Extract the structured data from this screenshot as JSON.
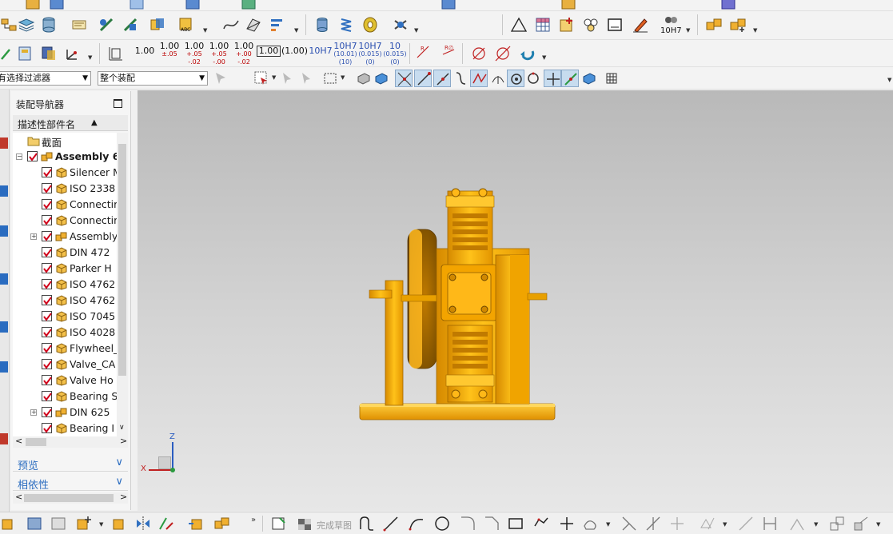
{
  "toolbar": {
    "dimension_buttons": [
      {
        "main": "1.00",
        "sub": ""
      },
      {
        "main": "1.00",
        "sub": "±.05"
      },
      {
        "main": "1.00",
        "sub": "+.05 -.02"
      },
      {
        "main": "1.00",
        "sub": "+.05 -.00"
      },
      {
        "main": "1.00",
        "sub": "+.00 -.02"
      },
      {
        "main": "1.00",
        "sub": ""
      },
      {
        "main": "(1.00)",
        "sub": ""
      },
      {
        "main": "10H7",
        "sub": ""
      },
      {
        "main": "10H7",
        "sub": "(10.01) (10)"
      },
      {
        "main": "10H7",
        "sub": "(0.015) (0)"
      },
      {
        "main": "10",
        "sub": "(0.015) (0)"
      }
    ],
    "fit_label": "10H7",
    "finish_sketch_label": "完成草图"
  },
  "filterbar": {
    "selection_filter": "有选择过滤器",
    "scope": "整个装配"
  },
  "navigator": {
    "title": "装配导航器",
    "column_header": "描述性部件名",
    "sort_indicator": "▲",
    "items": [
      {
        "label": "截面",
        "type": "folder",
        "level": 1,
        "checked": false,
        "bold": false,
        "expandable": false
      },
      {
        "label": "Assembly 6",
        "type": "assembly",
        "level": 1,
        "checked": true,
        "bold": true,
        "expandable": true
      },
      {
        "label": "Silencer M",
        "type": "part",
        "level": 2,
        "checked": true,
        "bold": false,
        "expandable": false
      },
      {
        "label": "ISO 2338",
        "type": "part",
        "level": 2,
        "checked": true,
        "bold": false,
        "expandable": false
      },
      {
        "label": "Connectir",
        "type": "part",
        "level": 2,
        "checked": true,
        "bold": false,
        "expandable": false
      },
      {
        "label": "Connectir",
        "type": "part",
        "level": 2,
        "checked": true,
        "bold": false,
        "expandable": false
      },
      {
        "label": "Assembly",
        "type": "assembly",
        "level": 2,
        "checked": true,
        "bold": false,
        "expandable": true
      },
      {
        "label": "DIN 472",
        "type": "part",
        "level": 2,
        "checked": true,
        "bold": false,
        "expandable": false
      },
      {
        "label": "Parker H",
        "type": "part",
        "level": 2,
        "checked": true,
        "bold": false,
        "expandable": false
      },
      {
        "label": "ISO 4762",
        "type": "part",
        "level": 2,
        "checked": true,
        "bold": false,
        "expandable": false
      },
      {
        "label": "ISO 4762",
        "type": "part",
        "level": 2,
        "checked": true,
        "bold": false,
        "expandable": false
      },
      {
        "label": "ISO 7045",
        "type": "part",
        "level": 2,
        "checked": true,
        "bold": false,
        "expandable": false
      },
      {
        "label": "ISO 4028",
        "type": "part",
        "level": 2,
        "checked": true,
        "bold": false,
        "expandable": false
      },
      {
        "label": "Flywheel_",
        "type": "part",
        "level": 2,
        "checked": true,
        "bold": false,
        "expandable": false
      },
      {
        "label": "Valve_CA",
        "type": "part",
        "level": 2,
        "checked": true,
        "bold": false,
        "expandable": false
      },
      {
        "label": "Valve Ho",
        "type": "part",
        "level": 2,
        "checked": true,
        "bold": false,
        "expandable": false
      },
      {
        "label": "Bearing S",
        "type": "part",
        "level": 2,
        "checked": true,
        "bold": false,
        "expandable": false
      },
      {
        "label": "DIN 625",
        "type": "assembly",
        "level": 2,
        "checked": true,
        "bold": false,
        "expandable": true
      },
      {
        "label": "Bearing I",
        "type": "part",
        "level": 2,
        "checked": true,
        "bold": false,
        "expandable": false
      }
    ],
    "preview_label": "预览",
    "dependency_label": "相依性"
  },
  "triad": {
    "z": "Z",
    "x": "X"
  },
  "colors": {
    "accent_blue": "#2a6cc0",
    "model_orange": "#f5a800",
    "checkbox_red": "#d0021b"
  }
}
